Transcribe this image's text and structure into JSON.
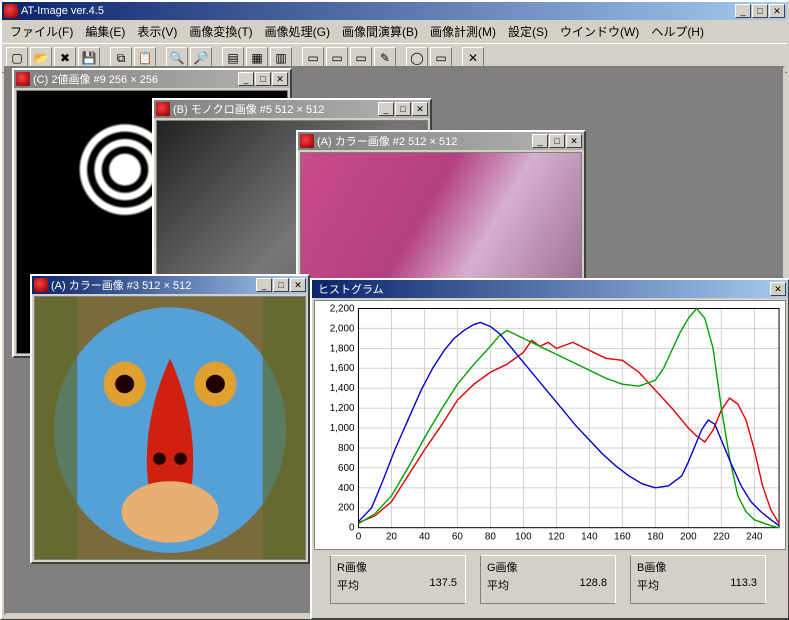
{
  "app": {
    "title": "AT-Image ver.4.5"
  },
  "menu": {
    "file": "ファイル(F)",
    "edit": "編集(E)",
    "view": "表示(V)",
    "convert": "画像変換(T)",
    "process": "画像処理(G)",
    "between": "画像間演算(B)",
    "measure": "画像計測(M)",
    "settings": "設定(S)",
    "window": "ウインドウ(W)",
    "help": "ヘルプ(H)"
  },
  "toolbar_icons": [
    "new",
    "open",
    "close",
    "save",
    "",
    "copy",
    "paste",
    "",
    "zoomout",
    "zoomin",
    "",
    "histogram",
    "grid",
    "palette",
    "",
    "docA",
    "docB",
    "docC",
    "pencil",
    "",
    "circle",
    "rect",
    "",
    "x"
  ],
  "windows": {
    "w1": {
      "title": "(C) 2値画像 #9  256 × 256"
    },
    "w2": {
      "title": "(B) モノクロ画像 #5  512 × 512"
    },
    "w3": {
      "title": "(A) カラー画像 #2  512 × 512"
    },
    "w4": {
      "title": "(A) カラー画像 #3  512 × 512"
    },
    "hist": {
      "title": "ヒストグラム"
    }
  },
  "stats": {
    "r": {
      "label": "R画像",
      "meanlabel": "平均",
      "mean": "137.5"
    },
    "g": {
      "label": "G画像",
      "meanlabel": "平均",
      "mean": "128.8"
    },
    "b": {
      "label": "B画像",
      "meanlabel": "平均",
      "mean": "113.3"
    }
  },
  "chart_data": {
    "type": "line",
    "title": "",
    "xlabel": "",
    "ylabel": "",
    "xlim": [
      0,
      255
    ],
    "ylim": [
      0,
      2200
    ],
    "xticks": [
      0,
      20,
      40,
      60,
      80,
      100,
      120,
      140,
      160,
      180,
      200,
      220,
      240
    ],
    "yticks": [
      0,
      200,
      400,
      600,
      800,
      1000,
      1200,
      1400,
      1600,
      1800,
      2000,
      2200
    ],
    "series": [
      {
        "name": "R",
        "color": "#e00000",
        "values": [
          [
            0,
            50
          ],
          [
            10,
            120
          ],
          [
            20,
            260
          ],
          [
            30,
            520
          ],
          [
            40,
            780
          ],
          [
            50,
            1020
          ],
          [
            60,
            1280
          ],
          [
            70,
            1440
          ],
          [
            80,
            1560
          ],
          [
            90,
            1640
          ],
          [
            100,
            1760
          ],
          [
            105,
            1880
          ],
          [
            110,
            1820
          ],
          [
            115,
            1860
          ],
          [
            120,
            1800
          ],
          [
            130,
            1860
          ],
          [
            140,
            1780
          ],
          [
            150,
            1700
          ],
          [
            160,
            1680
          ],
          [
            170,
            1560
          ],
          [
            180,
            1380
          ],
          [
            190,
            1200
          ],
          [
            200,
            1000
          ],
          [
            205,
            920
          ],
          [
            210,
            860
          ],
          [
            215,
            980
          ],
          [
            220,
            1180
          ],
          [
            225,
            1300
          ],
          [
            230,
            1240
          ],
          [
            235,
            1080
          ],
          [
            240,
            780
          ],
          [
            245,
            420
          ],
          [
            250,
            180
          ],
          [
            255,
            40
          ]
        ]
      },
      {
        "name": "G",
        "color": "#00a000",
        "values": [
          [
            0,
            40
          ],
          [
            10,
            140
          ],
          [
            20,
            320
          ],
          [
            30,
            600
          ],
          [
            40,
            900
          ],
          [
            50,
            1180
          ],
          [
            60,
            1440
          ],
          [
            70,
            1640
          ],
          [
            80,
            1820
          ],
          [
            85,
            1920
          ],
          [
            90,
            1980
          ],
          [
            95,
            1940
          ],
          [
            100,
            1900
          ],
          [
            110,
            1820
          ],
          [
            120,
            1740
          ],
          [
            130,
            1660
          ],
          [
            140,
            1580
          ],
          [
            150,
            1500
          ],
          [
            160,
            1440
          ],
          [
            170,
            1420
          ],
          [
            180,
            1480
          ],
          [
            185,
            1600
          ],
          [
            190,
            1780
          ],
          [
            195,
            1960
          ],
          [
            200,
            2100
          ],
          [
            205,
            2200
          ],
          [
            210,
            2100
          ],
          [
            215,
            1800
          ],
          [
            220,
            1200
          ],
          [
            225,
            700
          ],
          [
            230,
            320
          ],
          [
            235,
            160
          ],
          [
            240,
            80
          ],
          [
            250,
            20
          ],
          [
            255,
            0
          ]
        ]
      },
      {
        "name": "B",
        "color": "#0000d0",
        "values": [
          [
            0,
            60
          ],
          [
            8,
            200
          ],
          [
            15,
            480
          ],
          [
            22,
            780
          ],
          [
            30,
            1080
          ],
          [
            38,
            1380
          ],
          [
            45,
            1600
          ],
          [
            52,
            1780
          ],
          [
            58,
            1900
          ],
          [
            64,
            1980
          ],
          [
            70,
            2040
          ],
          [
            74,
            2060
          ],
          [
            80,
            2020
          ],
          [
            86,
            1940
          ],
          [
            92,
            1820
          ],
          [
            100,
            1660
          ],
          [
            108,
            1500
          ],
          [
            116,
            1340
          ],
          [
            124,
            1180
          ],
          [
            132,
            1020
          ],
          [
            140,
            880
          ],
          [
            148,
            740
          ],
          [
            156,
            620
          ],
          [
            164,
            520
          ],
          [
            172,
            440
          ],
          [
            180,
            400
          ],
          [
            188,
            420
          ],
          [
            196,
            520
          ],
          [
            200,
            660
          ],
          [
            204,
            820
          ],
          [
            208,
            980
          ],
          [
            212,
            1080
          ],
          [
            216,
            1040
          ],
          [
            220,
            880
          ],
          [
            226,
            640
          ],
          [
            232,
            420
          ],
          [
            238,
            260
          ],
          [
            244,
            160
          ],
          [
            250,
            80
          ],
          [
            255,
            20
          ]
        ]
      }
    ]
  }
}
